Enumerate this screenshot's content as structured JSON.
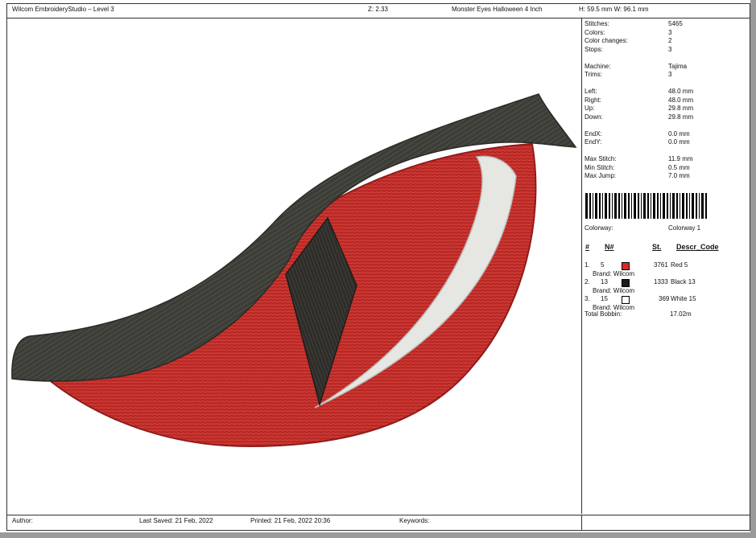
{
  "header": {
    "app_title": "Wilcom EmbroideryStudio – Level 3",
    "zoom": "Z: 2.33",
    "design_name": "Monster Eyes Halloween 4  Inch",
    "dimensions": "H: 59.5 mm   W: 96.1 mm"
  },
  "stats": [
    {
      "label": "Stitches:",
      "value": "5465"
    },
    {
      "label": "Colors:",
      "value": "3"
    },
    {
      "label": "Color changes:",
      "value": "2"
    },
    {
      "label": "Stops:",
      "value": "3"
    },
    {
      "label": "Machine:",
      "value": "Tajima"
    },
    {
      "label": "Trims:",
      "value": "3"
    },
    {
      "label": "Left:",
      "value": "48.0 mm"
    },
    {
      "label": "Right:",
      "value": "48.0 mm"
    },
    {
      "label": "Up:",
      "value": "29.8 mm"
    },
    {
      "label": "Down:",
      "value": "29.8 mm"
    },
    {
      "label": "EndX:",
      "value": "0.0 mm"
    },
    {
      "label": "EndY:",
      "value": "0.0 mm"
    },
    {
      "label": "Max Stitch:",
      "value": "11.9 mm"
    },
    {
      "label": "Min Stitch:",
      "value": "0.5 mm"
    },
    {
      "label": "Max Jump:",
      "value": "7.0 mm"
    }
  ],
  "colorway": {
    "label": "Colorway:",
    "value": "Colorway 1"
  },
  "thread_table": {
    "headers": {
      "index": "#",
      "number": "N#",
      "stitches": "St.",
      "description": "Descr_Code"
    },
    "rows": [
      {
        "index": "1.",
        "number": "5",
        "swatch": "#d42a2a",
        "stitches": "3761",
        "description": "Red 5",
        "brand": "Brand: Wilcom"
      },
      {
        "index": "2.",
        "number": "13",
        "swatch": "#1b1b1b",
        "stitches": "1333",
        "description": "Black 13",
        "brand": "Brand: Wilcom"
      },
      {
        "index": "3.",
        "number": "15",
        "swatch": "#ffffff",
        "stitches": "369",
        "description": "White 15",
        "brand": "Brand: Wilcom"
      }
    ]
  },
  "total_bobbin": {
    "label": "Total Bobbin:",
    "value": "17.02m"
  },
  "footer": {
    "author_label": "Author:",
    "last_saved": "Last Saved: 21 Feb, 2022",
    "printed": "Printed: 21 Feb, 2022 20:36",
    "keywords_label": "Keywords:"
  },
  "design_colors": {
    "red": "#c8302c",
    "red_dark": "#8e1c1a",
    "lid": "#3d3d38",
    "pupil": "#2e2d29",
    "highlight": "#e6e6e2"
  }
}
